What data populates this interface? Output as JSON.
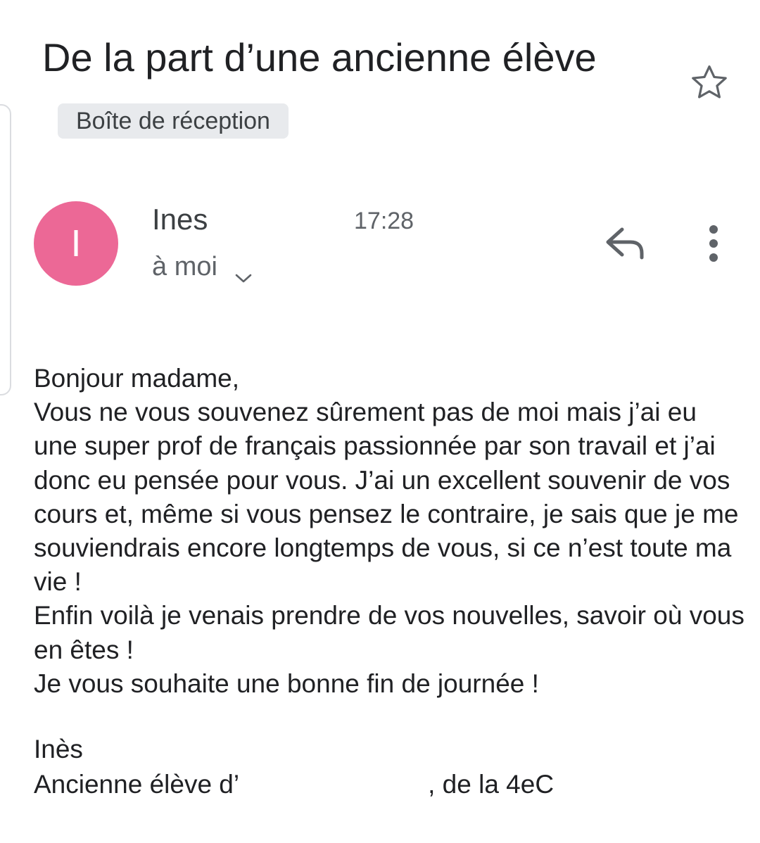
{
  "email": {
    "subject": "De la part d’une ancienne élève",
    "label": "Boîte de réception",
    "sender_initial": "I",
    "sender_name": "Ines",
    "time": "17:28",
    "recipient": "à moi",
    "body": [
      "Bonjour madame,",
      "Vous ne vous souvenez sûrement pas de moi mais j’ai eu une super prof de français passionnée par son travail et j’ai donc eu pensée pour vous. J’ai un excellent souvenir de vos cours et, même si vous pensez le contraire, je sais que je me souviendrais encore longtemps de vous, si ce n’est toute ma vie !",
      "Enfin voilà je venais prendre de vos nouvelles, savoir où vous en êtes !",
      "Je vous souhaite une bonne fin de journée !"
    ],
    "signature_name": "Inès",
    "signature_line_start": "Ancienne élève d’",
    "signature_line_end": ", de la 4eC"
  },
  "icons": {
    "star": "star-outline-icon",
    "reply": "reply-icon",
    "more": "more-vert-icon",
    "expand": "chevron-down-icon"
  },
  "colors": {
    "avatar": "#ec6896",
    "label_bg": "#e8eaed",
    "text": "#202124",
    "secondary_text": "#5f6368"
  }
}
